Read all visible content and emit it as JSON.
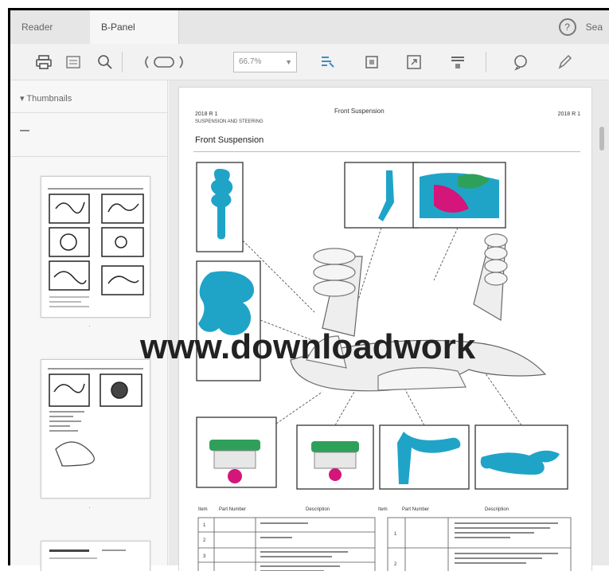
{
  "tabs": [
    {
      "label": "Reader"
    },
    {
      "label": "B-Panel"
    }
  ],
  "header_right": {
    "user_label": "Sea"
  },
  "toolbar": {
    "zoom_value": "66.7%",
    "icons": [
      "print-icon",
      "fit-page-icon",
      "search-icon",
      "page-nav-icon",
      "select-tool-icon",
      "crop-icon",
      "resize-icon",
      "highlight-icon",
      "comment-icon",
      "pen-icon"
    ]
  },
  "sidebar": {
    "header": "Thumbnails"
  },
  "document": {
    "header_left": "2018 R 1",
    "header_center": "Front Suspension",
    "header_right": "2018 R 1",
    "header_sub": "SUSPENSION AND STEERING",
    "page_title": "Front Suspension",
    "table_headers": [
      "Item",
      "Part Number",
      "Description",
      "Item",
      "Part Number",
      "Description"
    ]
  },
  "watermark": "www.downloadwork",
  "colors": {
    "accent": "#1fa4c8",
    "highlight": "#d4157a",
    "green": "#2fa05a"
  }
}
